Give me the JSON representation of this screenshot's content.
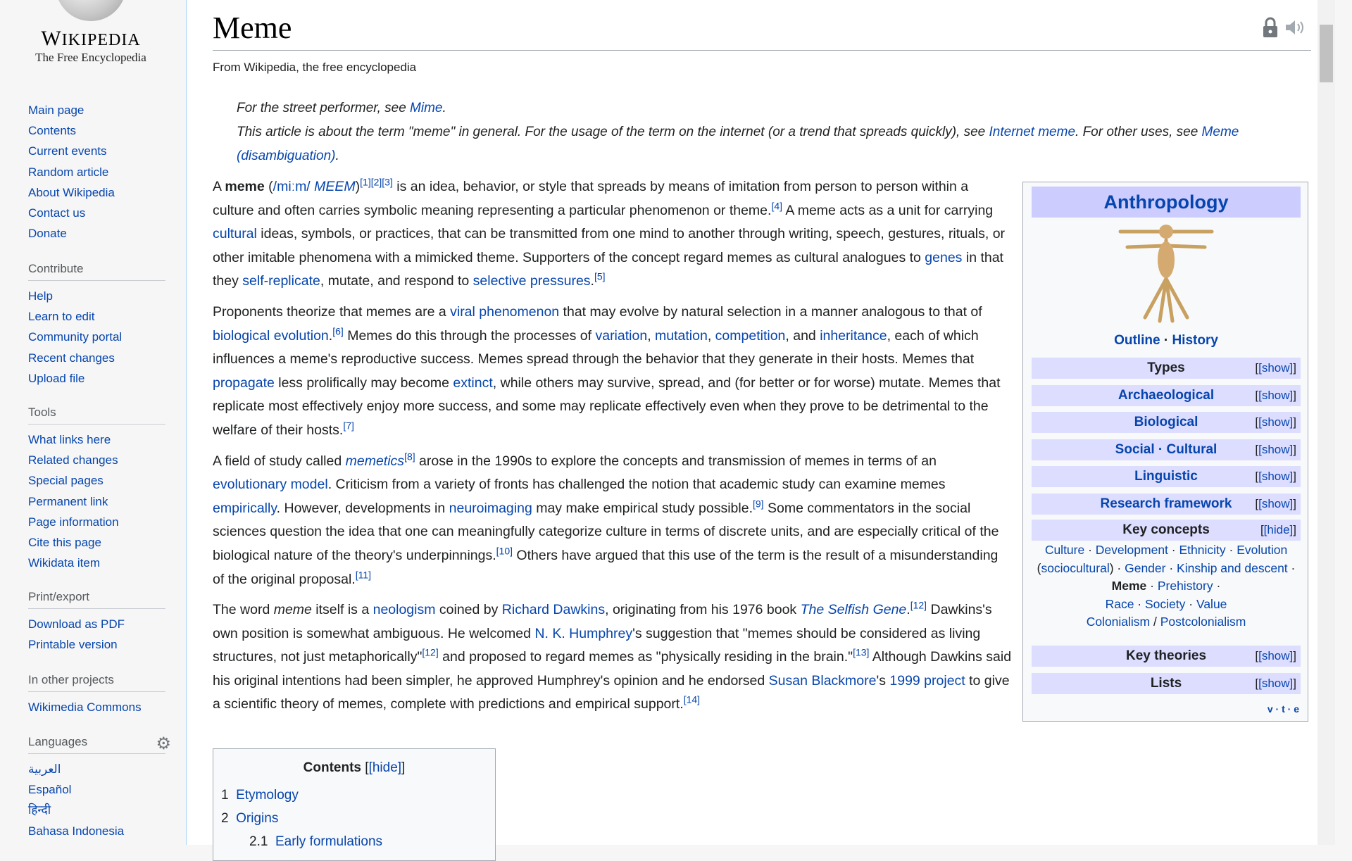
{
  "logo": {
    "wordmark": "Wikipedia",
    "tagline": "The Free Encyclopedia"
  },
  "nav": {
    "main": [
      "Main page",
      "Contents",
      "Current events",
      "Random article",
      "About Wikipedia",
      "Contact us",
      "Donate"
    ],
    "contribute_head": "Contribute",
    "contribute": [
      "Help",
      "Learn to edit",
      "Community portal",
      "Recent changes",
      "Upload file"
    ],
    "tools_head": "Tools",
    "tools": [
      "What links here",
      "Related changes",
      "Special pages",
      "Permanent link",
      "Page information",
      "Cite this page",
      "Wikidata item"
    ],
    "print_head": "Print/export",
    "print": [
      "Download as PDF",
      "Printable version"
    ],
    "projects_head": "In other projects",
    "projects": [
      "Wikimedia Commons"
    ],
    "languages_head": "Languages",
    "languages": [
      "العربية",
      "Español",
      "हिन्दी",
      "Bahasa Indonesia"
    ]
  },
  "article": {
    "title": "Meme",
    "tagline": "From Wikipedia, the free encyclopedia",
    "hatnote1_pre": "For the street performer, see ",
    "hatnote1_link": "Mime",
    "hatnote1_post": ".",
    "hatnote2_pre": "This article is about the term \"meme\" in general. For the usage of the term on the internet (or a trend that spreads quickly), see ",
    "hatnote2_link": "Internet meme",
    "hatnote2_mid": ". For other uses, see ",
    "hatnote2_link2": "Meme (disambiguation)",
    "hatnote2_post": "."
  },
  "infobox": {
    "title": "Anthropology",
    "outline": "Outline",
    "history": "History",
    "rows": [
      {
        "label": "Types",
        "toggle": "[show]"
      },
      {
        "label": "Archaeological",
        "toggle": "[show]"
      },
      {
        "label": "Biological",
        "toggle": "[show]"
      },
      {
        "label": "Social · Cultural",
        "toggle": "[show]"
      },
      {
        "label": "Linguistic",
        "toggle": "[show]"
      },
      {
        "label": "Research framework",
        "toggle": "[show]"
      },
      {
        "label": "Key concepts",
        "toggle": "[hide]"
      },
      {
        "label": "Key theories",
        "toggle": "[show]"
      },
      {
        "label": "Lists",
        "toggle": "[show]"
      }
    ],
    "concepts": {
      "culture": "Culture",
      "development": "Development",
      "ethnicity": "Ethnicity",
      "evolution": "Evolution",
      "sociocultural": "sociocultural",
      "gender": "Gender",
      "kinship": "Kinship and descent",
      "meme": "Meme",
      "prehistory": "Prehistory",
      "race": "Race",
      "society": "Society",
      "value": "Value",
      "colonialism": "Colonialism",
      "postcolonialism": "Postcolonialism"
    },
    "vte": "v · t · e"
  },
  "toc": {
    "title": "Contents",
    "toggle": "[hide]",
    "items": [
      {
        "num": "1",
        "label": "Etymology"
      },
      {
        "num": "2",
        "label": "Origins"
      },
      {
        "num": "2.1",
        "label": "Early formulations"
      }
    ]
  }
}
